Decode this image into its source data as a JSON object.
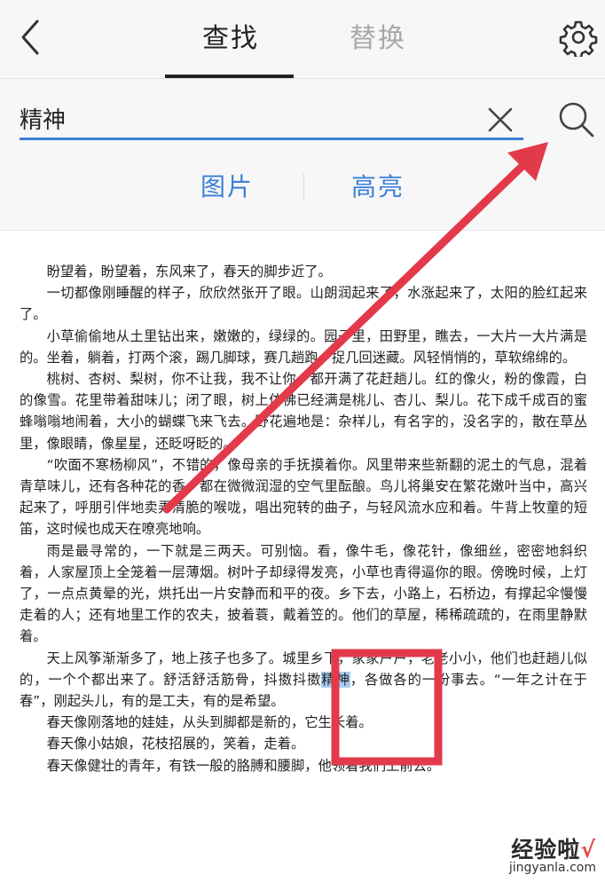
{
  "header": {
    "tabs": [
      {
        "label": "查找",
        "active": true
      },
      {
        "label": "替换",
        "active": false
      }
    ]
  },
  "search": {
    "value": "精神",
    "placeholder": "",
    "options": [
      "图片",
      "高亮"
    ]
  },
  "document": {
    "paragraphs": [
      [
        "盼望着，盼望着，东风来了，春天的脚步近了。"
      ],
      [
        "一切都像刚睡醒的样子，欣欣然张开了眼。山朗润起来了，水涨起来了，太阳的脸红起来了。"
      ],
      [
        "小草偷偷地从土里钻出来，嫩嫩的，绿绿的。园子里，田野里，瞧去，一大片一大片满是的。坐着，躺着，打两个滚，踢几脚球，赛几趟跑，捉几回迷藏。风轻悄悄的，草软绵绵的。"
      ],
      [
        "桃树、杏树、梨树，你不让我，我不让你，都开满了花赶趟儿。红的像火，粉的像霞，白的像雪。花里带着甜味儿；闭了眼，树上仿佛已经满是桃儿、杏儿、梨儿。花下成千成百的蜜蜂嗡嗡地闹着，大小的蝴蝶飞来飞去。野花遍地是：杂样儿，有名字的，没名字的，散在草丛里，像眼睛，像星星，还眨呀眨的。"
      ],
      [
        "“吹面不寒杨柳风”，不错的，像母亲的手抚摸着你。风里带来些新翻的泥土的气息，混着青草味儿，还有各种花的香，都在微微润湿的空气里酝酿。鸟儿将巢安在繁花嫩叶当中，高兴起来了，呼朋引伴地卖弄清脆的喉咙，唱出宛转的曲子，与轻风流水应和着。牛背上牧童的短笛，这时候也成天在嘹亮地响。"
      ],
      [
        "雨是最寻常的，一下就是三两天。可别恼。看，像牛毛，像花针，像细丝，密密地斜织着，人家屋顶上全笼着一层薄烟。树叶子却绿得发亮，小草也青得逼你的眼。傍晚时候，上灯了，一点点黄晕的光，烘托出一片安静而和平的夜。乡下去，小路上，石桥边，有撑起伞慢慢走着的人；还有地里工作的农夫，披着蓑，戴着笠的。他们的草屋，稀稀疏疏的，在雨里静默着。"
      ],
      [
        "天上风筝渐渐多了，地上孩子也多了。城里乡下，家家户户，老老小小，他们也赶趟儿似的，一个个都出来了。舒活舒活筋骨，抖擞抖擞",
        "精神",
        "，各做各的一份事去。“一年之计在于春”，刚起头儿，有的是工夫，有的是希望。"
      ],
      [
        "春天像刚落地的娃娃，从头到脚都是新的，它生长着。"
      ],
      [
        "春天像小姑娘，花枝招展的，笑着，走着。"
      ],
      [
        "春天像健壮的青年，有铁一般的胳膊和腰脚，他领着我们上前去。"
      ]
    ]
  },
  "annotations": {
    "arrow_color": "#e33a4b",
    "box_color": "#e33a4b"
  },
  "watermark": {
    "title": "经验啦",
    "check": "√",
    "url": "jingyanla.com"
  }
}
